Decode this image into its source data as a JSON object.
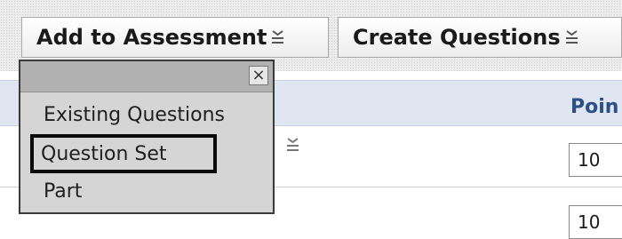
{
  "toolbar": {
    "add_to_assessment": "Add to Assessment",
    "create_questions": "Create Questions",
    "menu_icon": "menu-lines-icon"
  },
  "table": {
    "points_header": "Poin",
    "rows": [
      {
        "points": "10"
      },
      {
        "points": "10"
      }
    ]
  },
  "popup": {
    "close_label": "×",
    "items": [
      "Existing Questions",
      "Question Set",
      "Part"
    ],
    "selected": "Question Set"
  }
}
